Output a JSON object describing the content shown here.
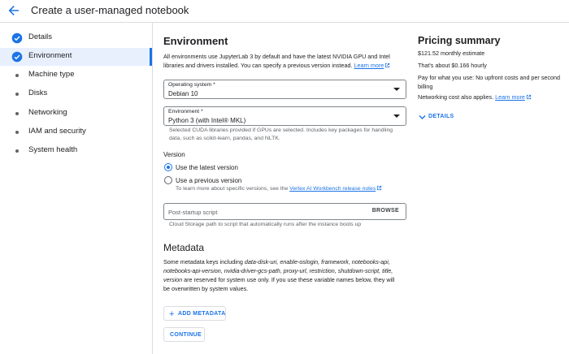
{
  "header": {
    "title": "Create a user-managed notebook"
  },
  "sidebar": {
    "items": [
      {
        "label": "Details",
        "state": "done"
      },
      {
        "label": "Environment",
        "state": "active"
      },
      {
        "label": "Machine type",
        "state": "pending"
      },
      {
        "label": "Disks",
        "state": "pending"
      },
      {
        "label": "Networking",
        "state": "pending"
      },
      {
        "label": "IAM and security",
        "state": "pending"
      },
      {
        "label": "System health",
        "state": "pending"
      }
    ]
  },
  "environment": {
    "heading": "Environment",
    "description_line1": "All environments use JupyterLab 3 by default and have the latest NVIDIA GPU and Intel",
    "description_line2": "libraries and drivers installed. You can specify a previous version instead.",
    "learn_more": "Learn more",
    "os_field": {
      "label": "Operating system *",
      "value": "Debian 10"
    },
    "env_field": {
      "label": "Environment *",
      "value": "Python 3 (with Intel® MKL)"
    },
    "env_helper_line1": "Selected CUDA libraries provided if GPUs are selected. Includes key packages for handling",
    "env_helper_line2": "data, such as scikit-learn, pandas, and NLTK.",
    "version": {
      "label": "Version",
      "options": [
        {
          "label": "Use the latest version",
          "selected": true
        },
        {
          "label": "Use a previous version",
          "selected": false
        }
      ],
      "hint_prefix": "To learn more about specific versions, see the",
      "hint_link": "Vertex AI Workbench release notes"
    },
    "post_startup": {
      "placeholder": "Post-startup script",
      "browse_label": "BROWSE",
      "helper": "Cloud Storage path to script that automatically runs after the instance boots up"
    }
  },
  "metadata": {
    "heading": "Metadata",
    "line1_prefix": "Some metadata keys including ",
    "line1_keys": "data-disk-uri, enable-oslogin, framework, notebooks-api,",
    "line2_keys": "notebooks-api-version, nvidia-driver-gcs-path, proxy-url, restriction, shutdown-script, title,",
    "line3_key": "version",
    "line3_suffix": " are reserved for system use only. If you use these variable names below, they will",
    "line4": "be overwritten by system values.",
    "add_button": "ADD METADATA"
  },
  "continue_button": "CONTINUE",
  "pricing": {
    "heading": "Pricing summary",
    "monthly": "$121.52 monthly estimate",
    "hourly": "That's about $0.166 hourly",
    "pay_line1": "Pay for what you use: No upfront costs and per second",
    "pay_line2": "billing",
    "networking_prefix": "Networking cost also applies.",
    "learn_more": "Learn more",
    "details_label": "DETAILS"
  },
  "colors": {
    "accent": "#1a73e8",
    "active_bg": "#e8f0fe",
    "border": "#dadce0",
    "muted": "#5f6368"
  }
}
